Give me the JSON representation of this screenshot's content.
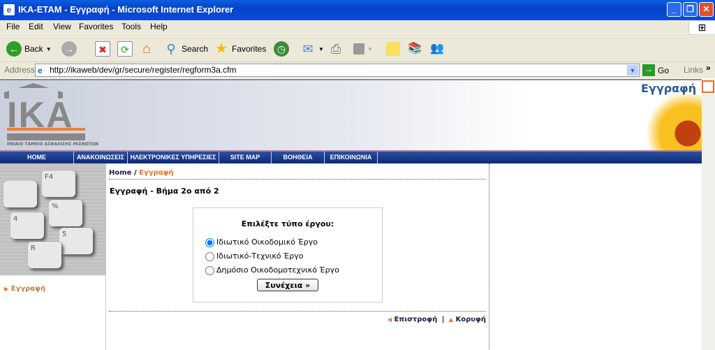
{
  "window": {
    "title": "IKA-ETAM - Εγγραφή - Microsoft Internet Explorer"
  },
  "menu": [
    "File",
    "Edit",
    "View",
    "Favorites",
    "Tools",
    "Help"
  ],
  "toolbar": {
    "back": "Back",
    "search": "Search",
    "favorites": "Favorites"
  },
  "address": {
    "label": "Address",
    "url": "http://ikaweb/dev/gr/secure/register/regform3a.cfm",
    "go": "Go",
    "links": "Links"
  },
  "banner": {
    "logo_text": "IKA",
    "logo_subtitle": "ΕΝΙΑΙΟ ΤΑΜΕΙΟ ΑΣΦΑΛΙΣΗΣ ΜΙΣΘΩΤΩΝ",
    "page_title": "Εγγραφή"
  },
  "nav": [
    "HOME",
    "ΑΝΑΚΟΙΝΩΣΕΙΣ",
    "ΗΛΕΚΤΡΟΝΙΚΕΣ ΥΠΗΡΕΣΙΕΣ",
    "SITE MAP",
    "ΒΟΗΘΕΙΑ",
    "ΕΠΙΚΟΙΝΩΝΙΑ"
  ],
  "sidebar": {
    "items": [
      {
        "label": "Εγγραφή"
      }
    ]
  },
  "breadcrumb": {
    "home": "Home",
    "sep": "/",
    "current": "Εγγραφή"
  },
  "heading": "Εγγραφή - Βήμα 2ο από 2",
  "form": {
    "title": "Επιλέξτε τύπο έργου:",
    "options": [
      {
        "label": "Ιδιωτικό Οικοδομικό Έργο",
        "checked": true
      },
      {
        "label": "Ιδιωτικό-Τεχνικό Έργο",
        "checked": false
      },
      {
        "label": "Δημόσιο Οικοδομοτεχνικό Έργο",
        "checked": false
      }
    ],
    "submit": "Συνέχεια »"
  },
  "footer": {
    "back": "Επιστροφή",
    "sep": "|",
    "top": "Κορυφή"
  },
  "colors": {
    "accent": "#f07020",
    "nav": "#0c2a78",
    "text": "#1a1a40"
  }
}
